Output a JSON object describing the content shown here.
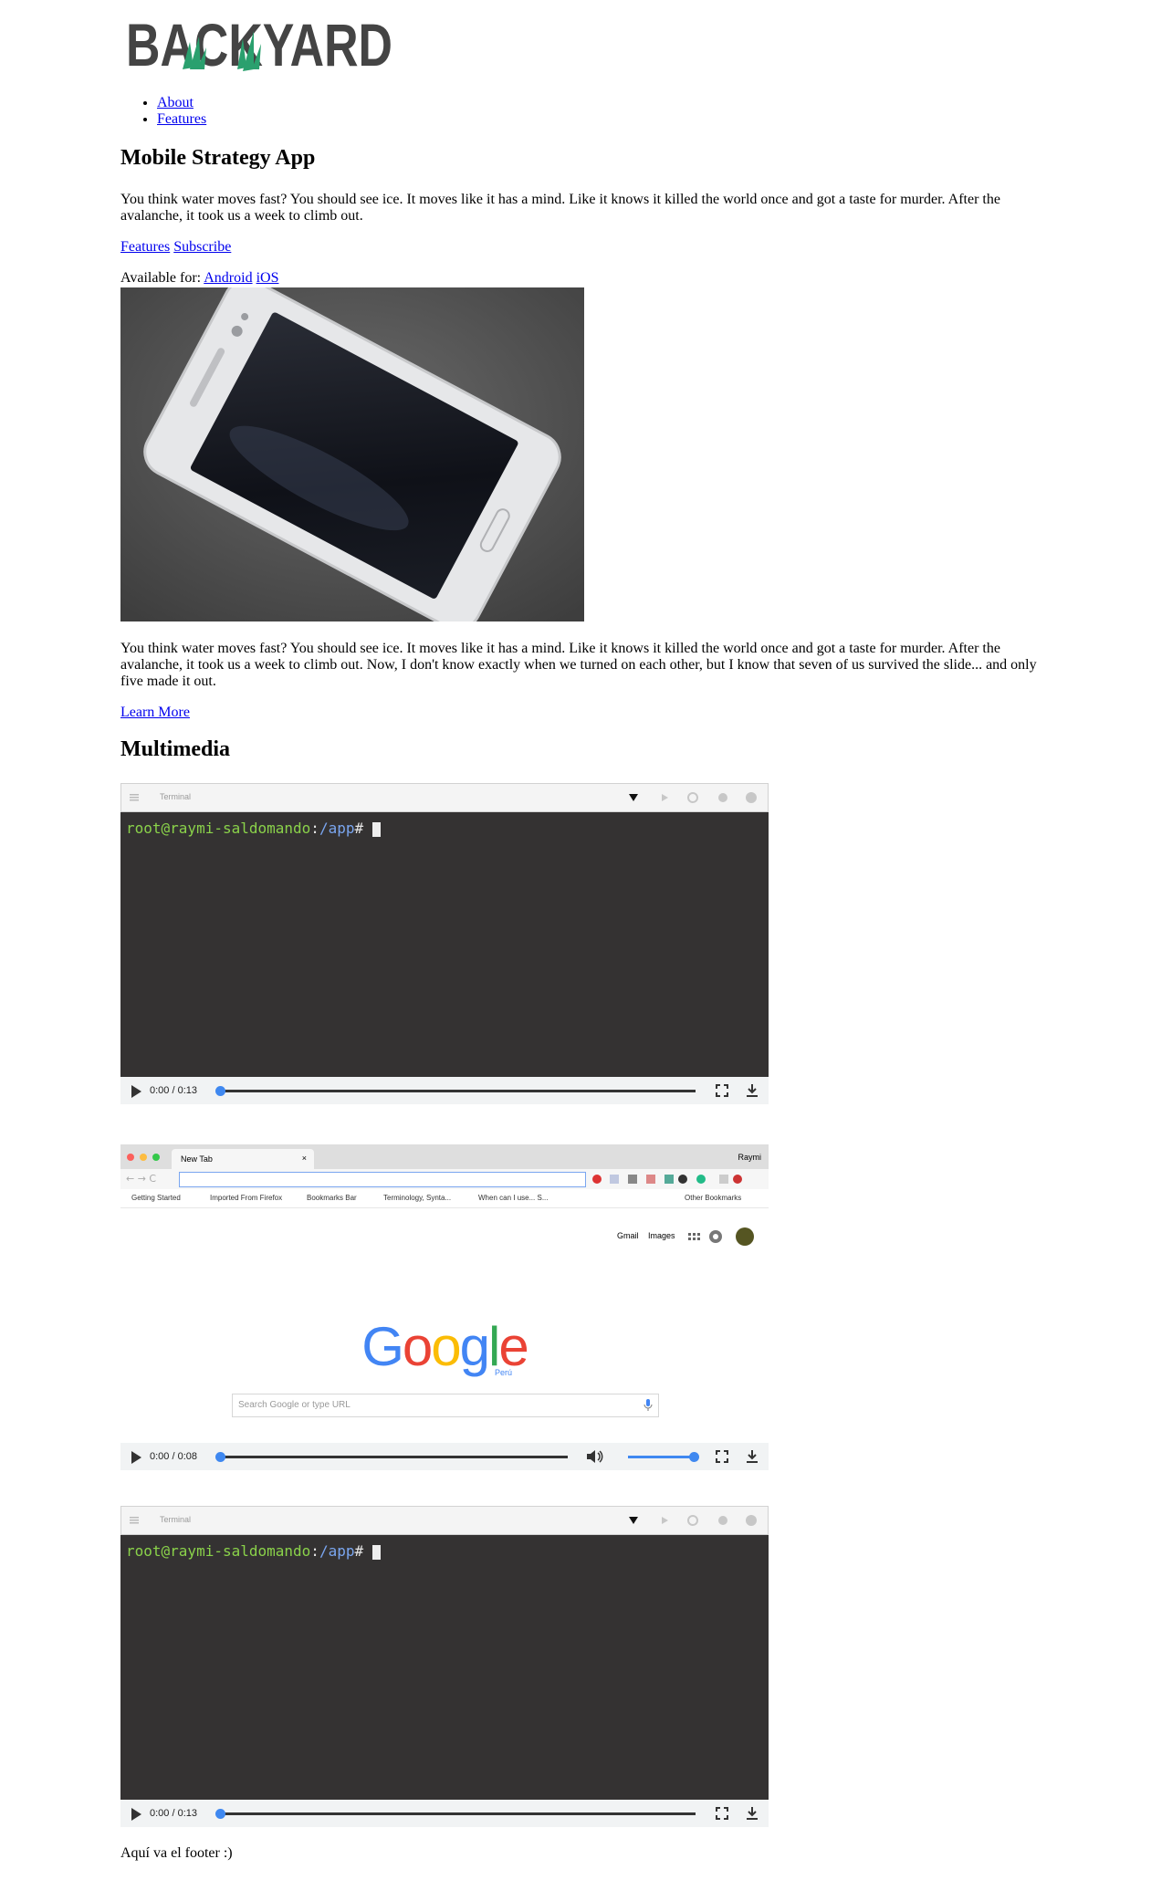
{
  "logo": {
    "text": "BACKYARD",
    "accent_color": "#2aa06e"
  },
  "nav": [
    {
      "label": "About"
    },
    {
      "label": "Features"
    }
  ],
  "hero": {
    "title": "Mobile Strategy App",
    "intro": "You think water moves fast? You should see ice. It moves like it has a mind. Like it knows it killed the world once and got a taste for murder. After the avalanche, it took us a week to climb out.",
    "links": [
      {
        "label": "Features"
      },
      {
        "label": "Subscribe"
      }
    ],
    "available_label": "Available for:",
    "platforms": [
      {
        "label": "Android"
      },
      {
        "label": "iOS"
      }
    ]
  },
  "body_text": "You think water moves fast? You should see ice. It moves like it has a mind. Like it knows it killed the world once and got a taste for murder. After the avalanche, it took us a week to climb out. Now, I don't know exactly when we turned on each other, but I know that seven of us survived the slide... and only five made it out.",
  "learn_more": "Learn More",
  "multimedia": {
    "title": "Multimedia",
    "videos": [
      {
        "type": "terminal",
        "tab_label": "Terminal",
        "prompt_user": "root@raymi-saldomando",
        "prompt_sep": ":",
        "prompt_path": "/app",
        "prompt_hash": "#",
        "time": "0:00 / 0:13"
      },
      {
        "type": "browser",
        "tab_title": "New Tab",
        "profile": "Raymi",
        "bookmarks": [
          "Getting Started",
          "Imported From Firefox",
          "Bookmarks Bar",
          "Terminology, Synta...",
          "When can I use... S...",
          "Other Bookmarks"
        ],
        "top_links": [
          "Gmail",
          "Images"
        ],
        "search_placeholder": "Search Google or type URL",
        "google_text": "Google",
        "google_sub": "Perú",
        "time": "0:00 / 0:08",
        "volume": 1.0
      },
      {
        "type": "terminal",
        "tab_label": "Terminal",
        "prompt_user": "root@raymi-saldomando",
        "prompt_sep": ":",
        "prompt_path": "/app",
        "prompt_hash": "#",
        "time": "0:00 / 0:13"
      }
    ]
  },
  "footer": "Aquí va el footer :)"
}
